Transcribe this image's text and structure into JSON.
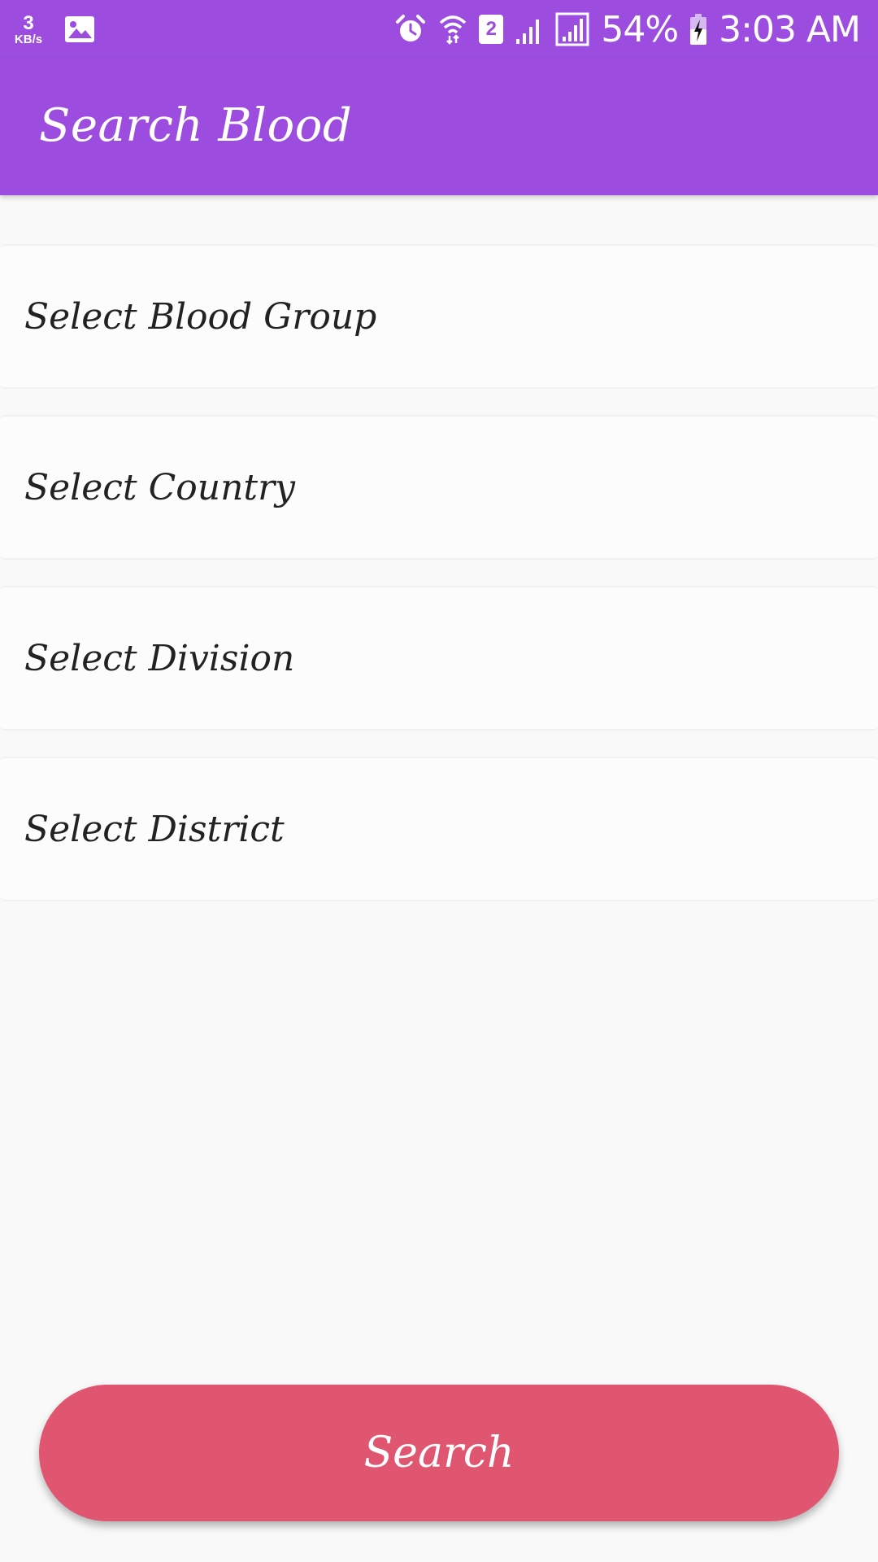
{
  "status_bar": {
    "net_speed_value": "3",
    "net_speed_unit": "KB/s",
    "sim_slot": "2",
    "battery": "54%",
    "time": "3:03 AM",
    "icons": [
      "gallery-icon",
      "alarm-icon",
      "wifi-icon",
      "sim-2-icon",
      "signal-icon",
      "signal-icon",
      "battery-charging-icon"
    ]
  },
  "app_bar": {
    "title": "Search Blood"
  },
  "selects": [
    {
      "label": "Select Blood Group"
    },
    {
      "label": "Select Country"
    },
    {
      "label": "Select Division"
    },
    {
      "label": "Select District"
    }
  ],
  "search_button": {
    "label": "Search"
  },
  "colors": {
    "primary": "#9c4ddf",
    "button": "#e05670",
    "background": "#f9f9fa",
    "card": "#fcfcfc",
    "text": "#222222"
  }
}
